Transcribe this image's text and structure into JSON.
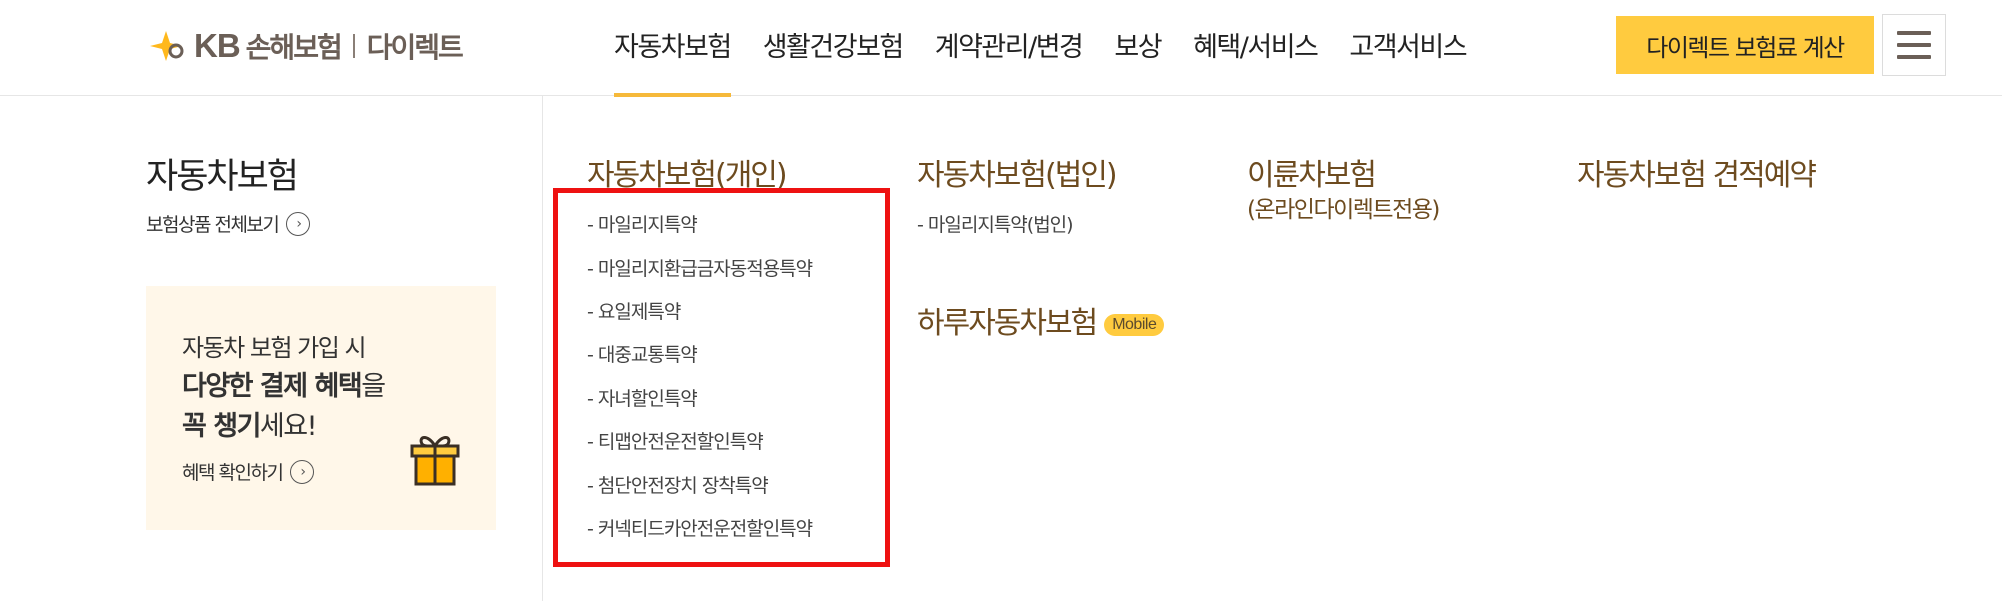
{
  "header": {
    "logo_kb": "KB",
    "logo_name": "손해보험",
    "logo_direct": "다이렉트",
    "nav": [
      "자동차보험",
      "생활건강보험",
      "계약관리/변경",
      "보상",
      "혜택/서비스",
      "고객서비스"
    ],
    "calc_button": "다이렉트 보험료 계산",
    "accent_color": "#ffcb3f",
    "active_underline_color": "#f6b93a",
    "brand_brown": "#6b5f57"
  },
  "left": {
    "title": "자동차보험",
    "view_all": "보험상품 전체보기",
    "promo": {
      "line1": "자동차 보험 가입 시",
      "line2_bold": "다양한 결제 혜택",
      "line2_rest": "을",
      "line3_bold": "꼭 챙기",
      "line3_rest": "세요!",
      "link": "혜택 확인하기"
    }
  },
  "columns": {
    "personal": {
      "title": "자동차보험(개인)",
      "items": [
        "- 마일리지특약",
        "- 마일리지환급금자동적용특약",
        "- 요일제특약",
        "- 대중교통특약",
        "- 자녀할인특약",
        "- 티맵안전운전할인특약",
        "- 첨단안전장치 장착특약",
        "- 커넥티드카안전운전할인특약"
      ]
    },
    "corporate": {
      "title": "자동차보험(법인)",
      "items": [
        "- 마일리지특약(법인)"
      ]
    },
    "daily": {
      "title": "하루자동차보험",
      "badge": "Mobile"
    },
    "twowheel": {
      "title": "이륜차보험",
      "subtitle": "(온라인다이렉트전용)"
    },
    "estimate": {
      "title": "자동차보험 견적예약"
    }
  },
  "highlight_color": "#ee1111"
}
